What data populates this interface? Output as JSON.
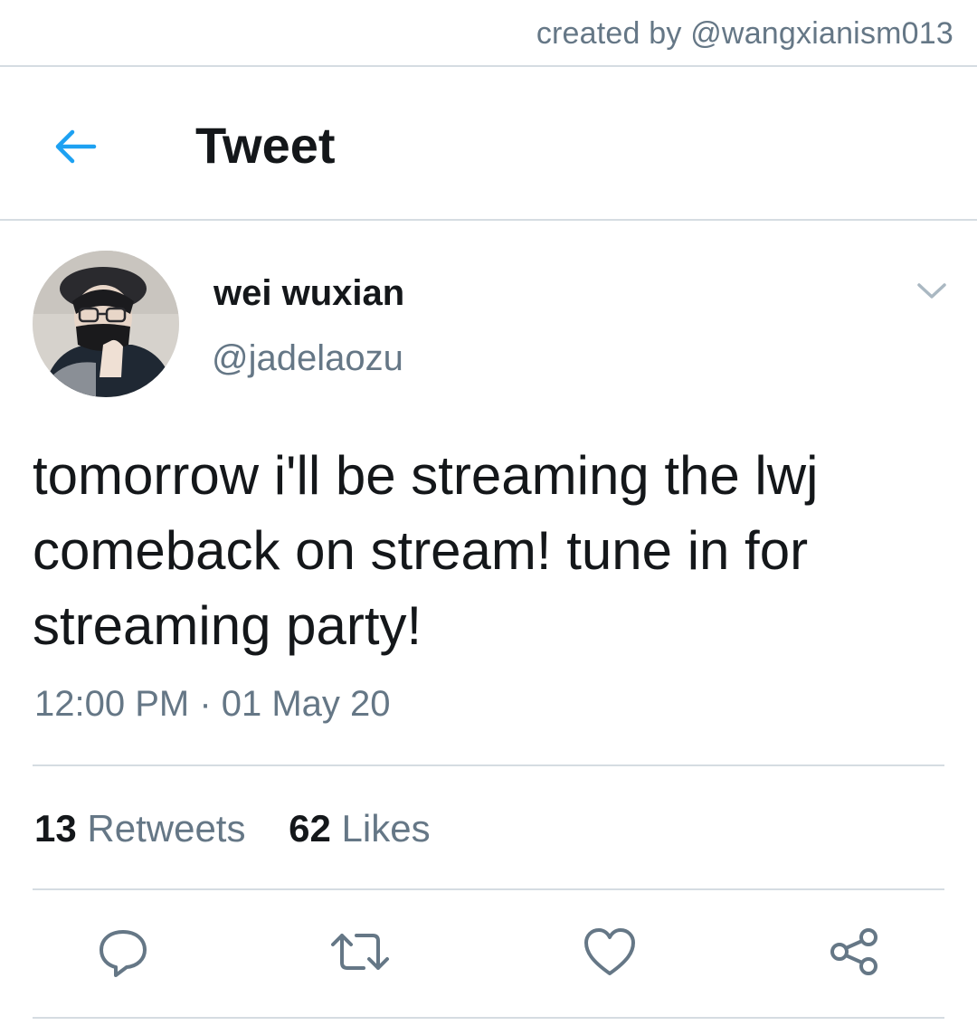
{
  "watermark": {
    "text": "created by @wangxianism013"
  },
  "header": {
    "title": "Tweet",
    "back_icon": "arrow-left-icon",
    "accent_color": "#1da1f2"
  },
  "tweet": {
    "author": {
      "display_name": "wei wuxian",
      "handle": "@jadelaozu"
    },
    "menu_icon": "chevron-down-icon",
    "text": "tomorrow i'll be streaming the lwj comeback on stream! tune in for streaming party!",
    "timestamp": "12:00 PM · 01 May 20",
    "stats": {
      "retweets_count": "13",
      "retweets_label": "Retweets",
      "likes_count": "62",
      "likes_label": "Likes"
    },
    "actions": [
      {
        "icon": "reply-icon"
      },
      {
        "icon": "retweet-icon"
      },
      {
        "icon": "heart-icon"
      },
      {
        "icon": "share-icon"
      }
    ]
  },
  "colors": {
    "primary_text": "#14171a",
    "secondary_text": "#657786",
    "divider": "#d5dce2"
  }
}
